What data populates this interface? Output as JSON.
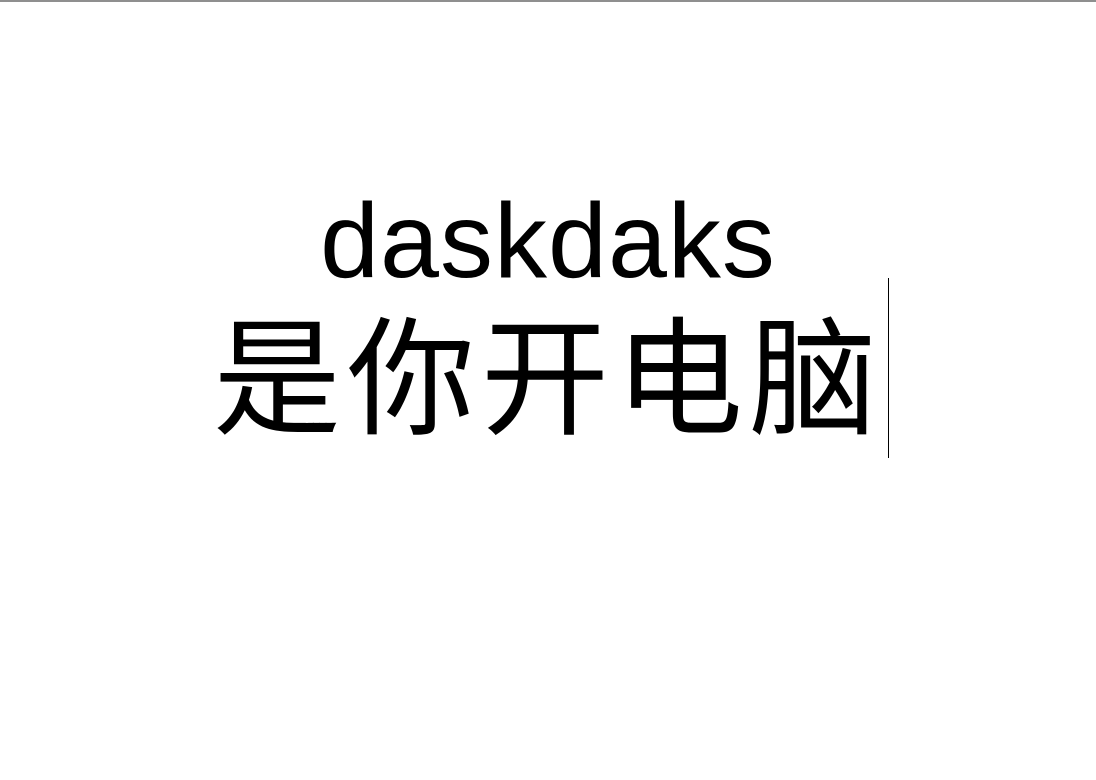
{
  "document": {
    "line1": "daskdaks",
    "line2": "是你开电脑"
  },
  "colors": {
    "background": "#ffffff",
    "text": "#000000",
    "top_border": "#8f8f8f"
  }
}
